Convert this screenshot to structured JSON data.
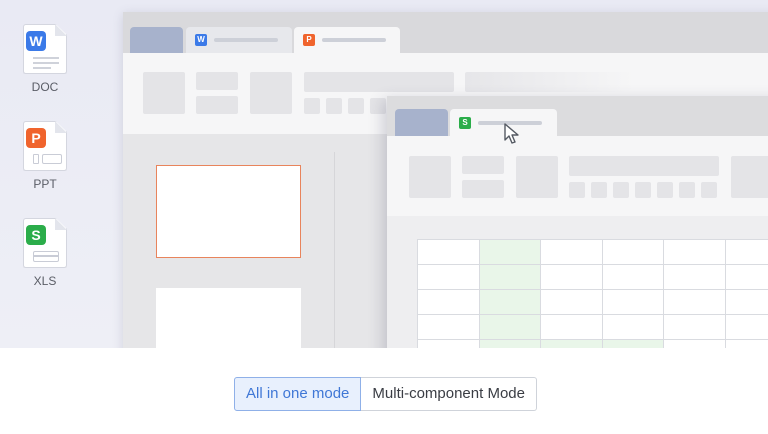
{
  "desktop_files": [
    {
      "label": "DOC",
      "badge": "W",
      "badge_color": "#3b7ae8",
      "icon": "doc-file-icon"
    },
    {
      "label": "PPT",
      "badge": "P",
      "badge_color": "#f0642d",
      "icon": "ppt-file-icon"
    },
    {
      "label": "XLS",
      "badge": "S",
      "badge_color": "#2bad4a",
      "icon": "xls-file-icon"
    }
  ],
  "back_window": {
    "tabs": [
      {
        "icon": "blank-tab"
      },
      {
        "icon": "writer-tab-icon",
        "badge": "W",
        "badge_color": "#3b7ae8"
      },
      {
        "icon": "presentation-tab-icon",
        "badge": "P",
        "badge_color": "#f0642d",
        "active": true
      }
    ]
  },
  "front_window": {
    "tabs": [
      {
        "icon": "blank-tab"
      },
      {
        "icon": "spreadsheet-tab-icon",
        "badge": "S",
        "badge_color": "#2bad4a",
        "active": true
      }
    ]
  },
  "mode_switch": {
    "options": [
      {
        "label": "All in one mode",
        "selected": true
      },
      {
        "label": "Multi-component Mode",
        "selected": false
      }
    ],
    "accent_color": "#3f77d6"
  }
}
